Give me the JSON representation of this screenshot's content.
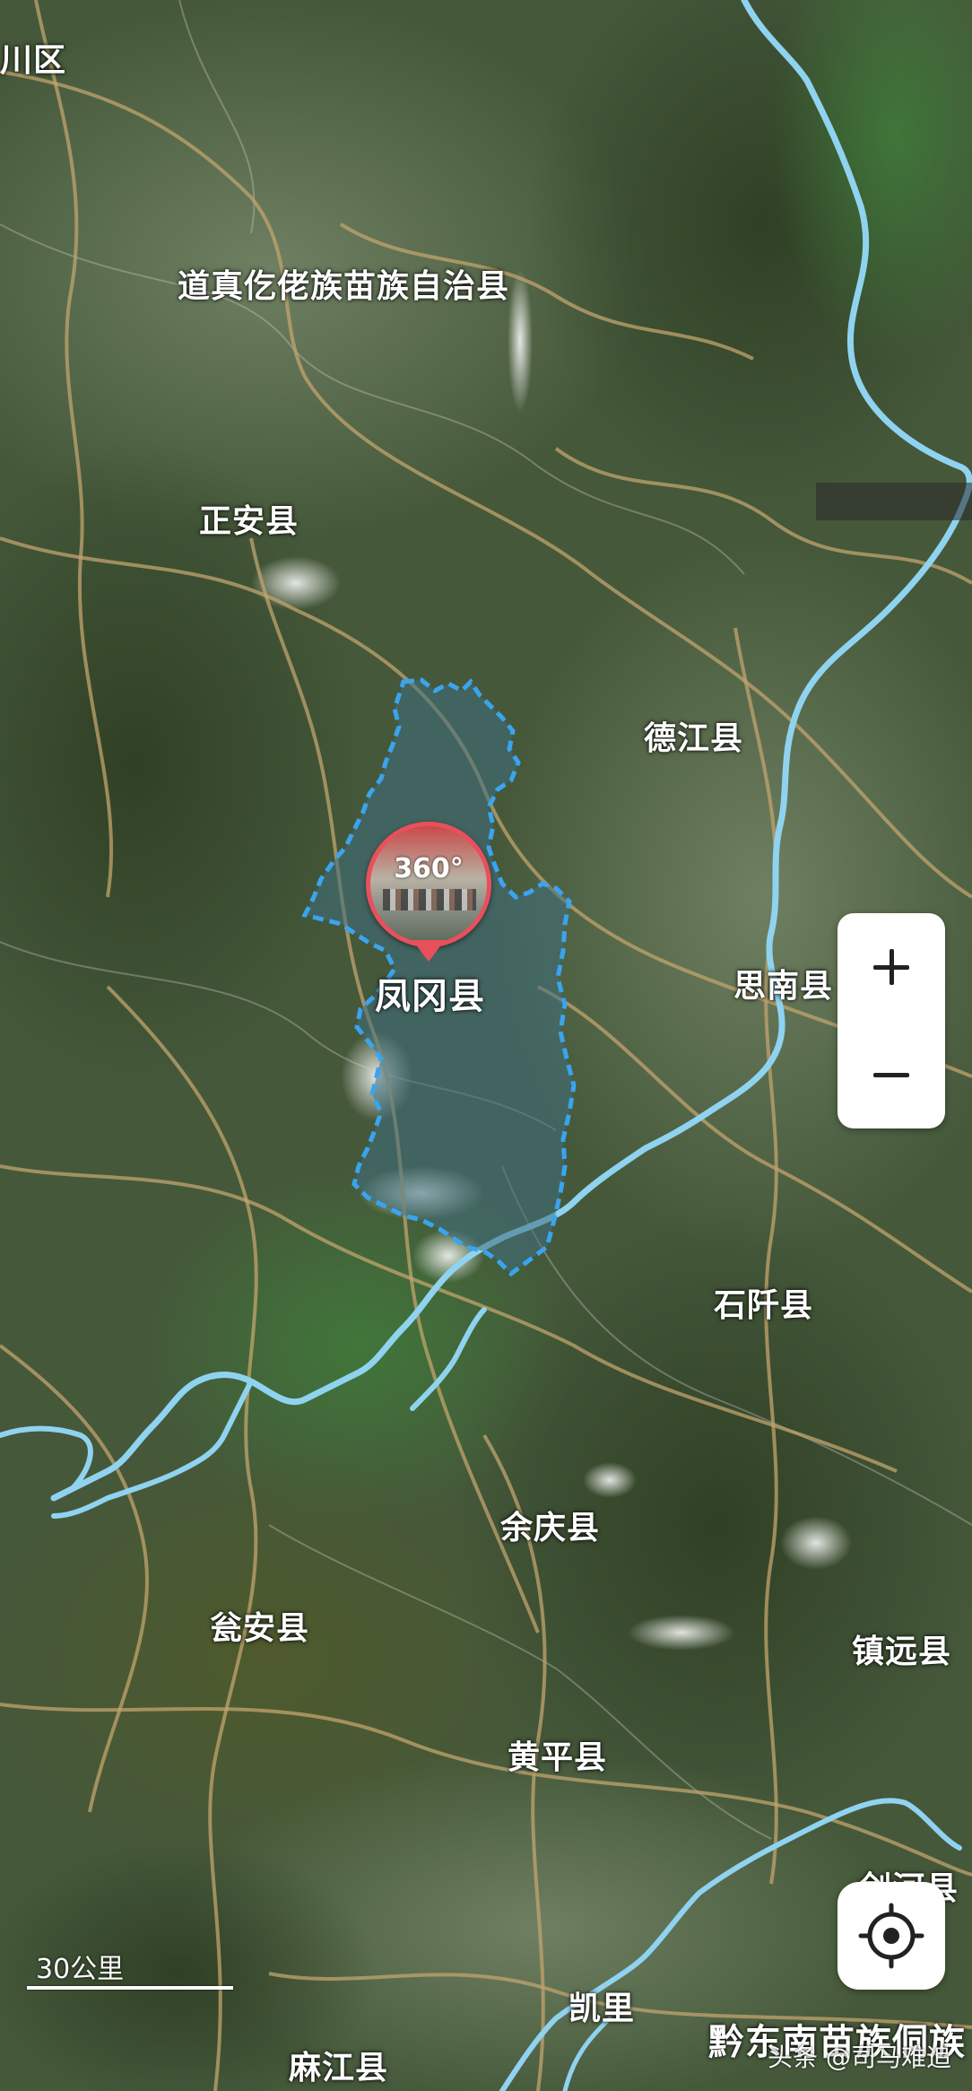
{
  "labels": {
    "chuan_qu": "川区",
    "daozhen": "道真仡佬族苗族自治县",
    "zhengan": "正安县",
    "dejiang": "德江县",
    "fenggang": "凤冈县",
    "sinan": "思南县",
    "shiqian": "石阡县",
    "yuqing": "余庆县",
    "wengan": "瓮安县",
    "zhenyuan": "镇远县",
    "huangping": "黄平县",
    "jianhe": "剑河县",
    "kaili": "凯里",
    "majiang": "麻江县",
    "qiandongnan": "黔东南苗族侗族"
  },
  "marker": {
    "text": "360°"
  },
  "scale": {
    "text": "30公里"
  },
  "watermark": {
    "text": "头条 @司马难追"
  },
  "colors": {
    "river": "#8fd3f0",
    "boundary": "#3aa4ee",
    "road": "#b99a6a",
    "marker": "#e8505b"
  },
  "icons": {
    "zoom_in": "plus-icon",
    "zoom_out": "minus-icon",
    "locate": "locate-crosshair-icon"
  }
}
